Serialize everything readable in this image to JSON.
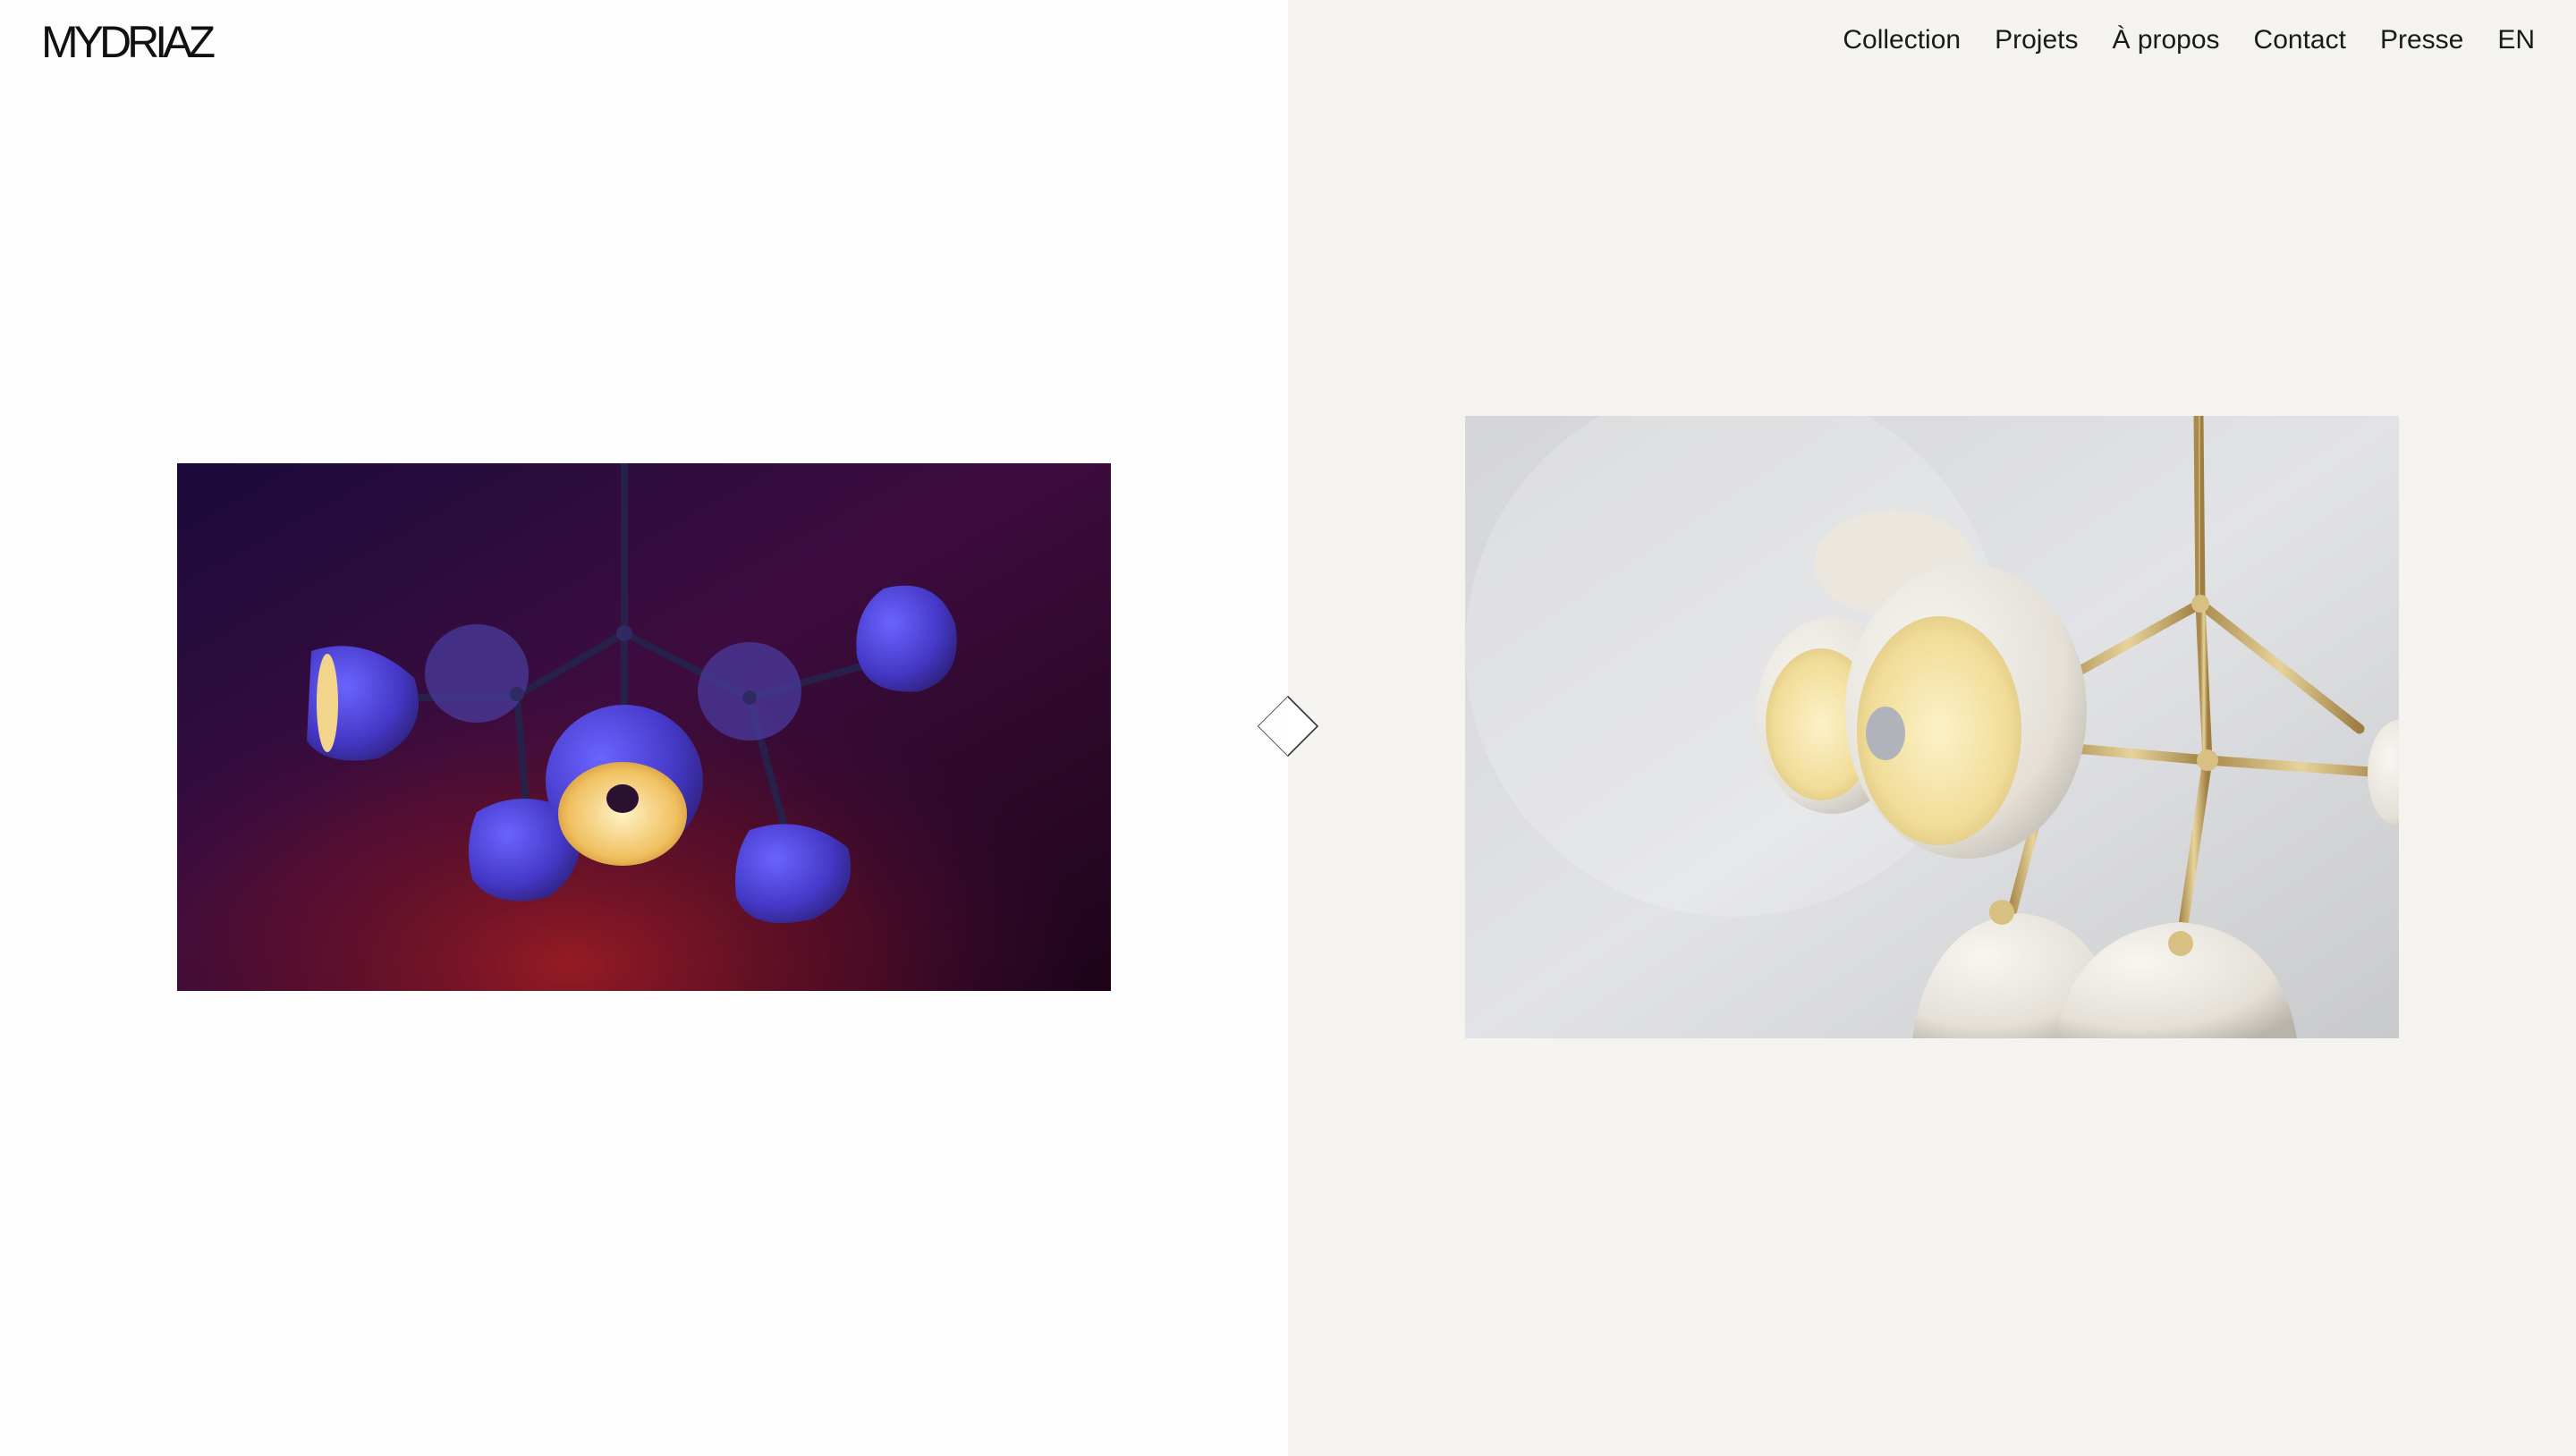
{
  "header": {
    "logo_text": "MYDRIAZ",
    "nav": [
      {
        "label": "Collection"
      },
      {
        "label": "Projets"
      },
      {
        "label": "À propos"
      },
      {
        "label": "Contact"
      },
      {
        "label": "Presse"
      },
      {
        "label": "EN"
      }
    ]
  },
  "colors": {
    "left_background": "#fdfdfd",
    "right_background": "#f4f3ef",
    "text": "#1a1a1a"
  },
  "images": {
    "left": "chandelier-photo-purple-red",
    "right": "chandelier-photo-white-brass"
  },
  "controls": {
    "compare_handle_icon": "diamond-icon"
  }
}
